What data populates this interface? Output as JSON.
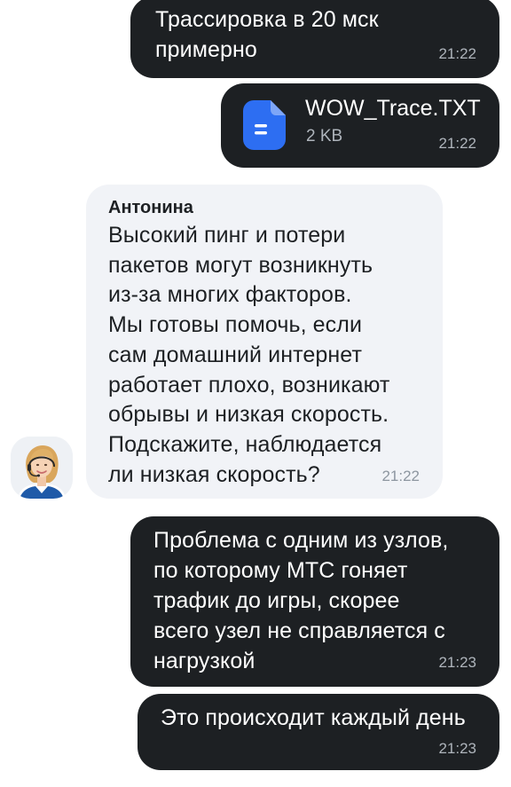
{
  "messages": [
    {
      "text": "Трассировка в 20 мск\nпримерно",
      "time": "21:22"
    },
    {
      "file": {
        "name": "WOW_Trace.TXT",
        "size": "2 KB"
      },
      "time": "21:22"
    },
    {
      "sender": "Антонина",
      "text": "Высокий пинг и потери\nпакетов могут возникнуть\nиз-за многих факторов.\nМы готовы помочь, если\nсам домашний интернет\nработает плохо, возникают\nобрывы и низкая скорость.\nПодскажите, наблюдается\nли низкая скорость?",
      "time": "21:22",
      "avatar": "operator-avatar"
    },
    {
      "text": "Проблема с одним из узлов,\nпо которому МТС гоняет\nтрафик до игры, скорее\nвсего узел не справляется с\nнагрузкой",
      "time": "21:23"
    },
    {
      "text": "Это происходит каждый день",
      "time": "21:23"
    }
  ],
  "colors": {
    "outgoing_bubble": "#1d2023",
    "incoming_bubble": "#f1f3f7",
    "file_icon": "#2d6ef2"
  }
}
